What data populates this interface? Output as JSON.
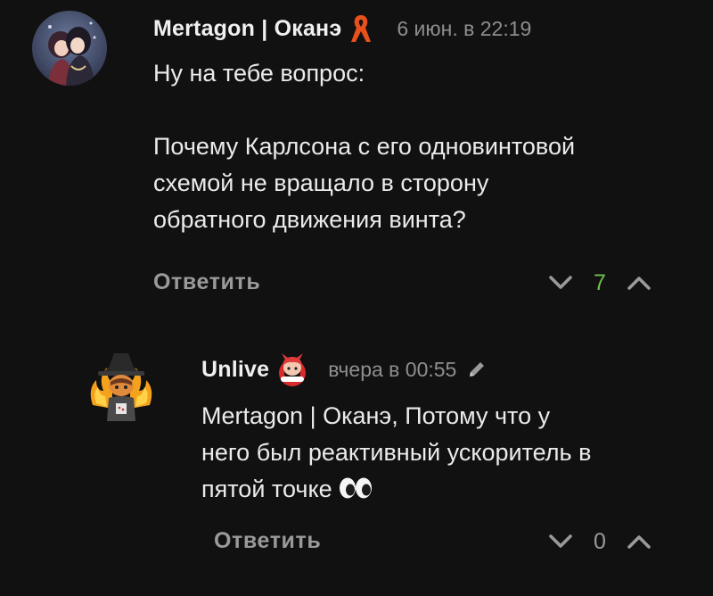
{
  "comments": [
    {
      "author": "Mertagon | Оканэ",
      "badge_icon": "ribbon-icon",
      "badge_color": "#e8501c",
      "timestamp": "6 июн. в 22:19",
      "paragraphs": [
        "Ну на тебе вопрос:",
        "Почему Карлсона с его одновинтовой",
        "схемой не вращало в сторону",
        "обратного движения винта?"
      ],
      "reply_label": "Ответить",
      "vote_count": "7",
      "vote_count_color": "#6fbf4e"
    },
    {
      "author": "Unlive",
      "badge_icon": "anime-girl-icon",
      "badge_color": "#e53935",
      "timestamp": "вчера в 00:55",
      "edited_icon": "pencil-icon",
      "lines": [
        "Mertagon | Оканэ, Потому что у",
        "него был реактивный ускоритель в",
        "пятой точке"
      ],
      "trailing_emoji": "eyes-emoji",
      "reply_label": "Ответить",
      "vote_count": "0",
      "vote_count_color": "#9a9a9a"
    }
  ]
}
